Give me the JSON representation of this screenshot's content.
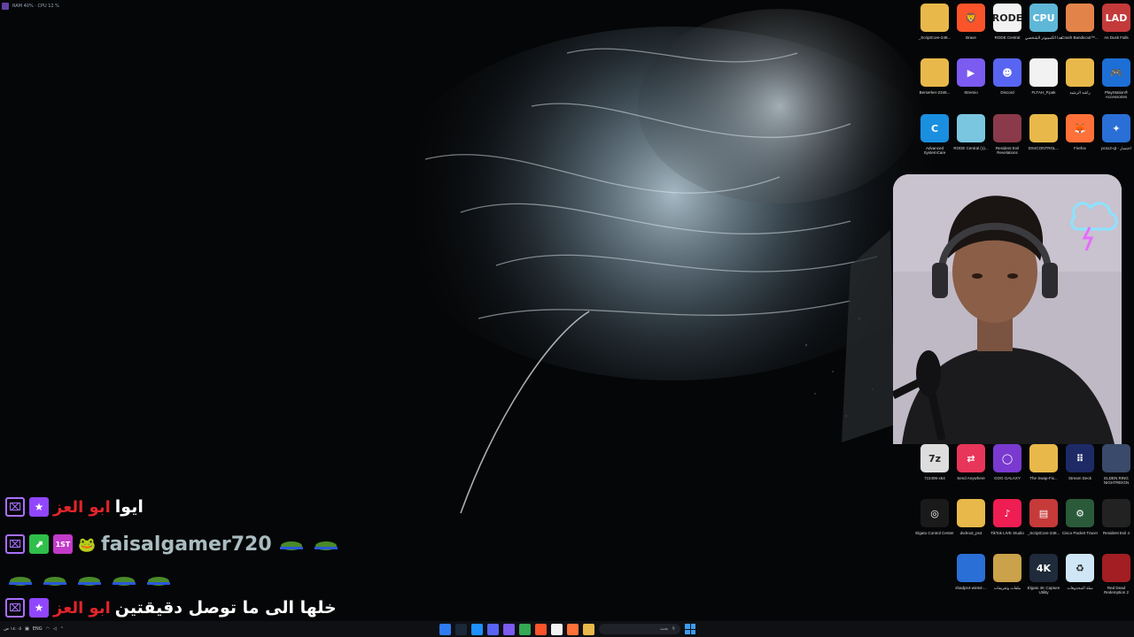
{
  "stats": {
    "text": "RAM 40% · CPU 12 %"
  },
  "desktop_icons": [
    {
      "id": "scriptcore",
      "label": "_ScriptCore-248...",
      "color": "#e8b94a",
      "glyph": ""
    },
    {
      "id": "brave",
      "label": "Brave",
      "color": "#fb542b",
      "glyph": "🦁"
    },
    {
      "id": "rode",
      "label": "RODE Central",
      "color": "#f2f2f2",
      "glyph": "RODE"
    },
    {
      "id": "thispc",
      "label": "هذا الكمبيوتر الشخصي",
      "color": "#5fb7d8",
      "glyph": "CPU"
    },
    {
      "id": "crash",
      "label": "Crash Bandicoot™...",
      "color": "#e2844a",
      "glyph": ""
    },
    {
      "id": "asdusk",
      "label": "As Dusk Falls",
      "color": "#c43a3a",
      "glyph": "LAD"
    },
    {
      "id": "berserker",
      "label": "Berserker-2346...",
      "color": "#e8b94a",
      "glyph": ""
    },
    {
      "id": "stremio",
      "label": "Stremio",
      "color": "#7b5bf0",
      "glyph": "▶"
    },
    {
      "id": "discord",
      "label": "Discord",
      "color": "#5865f2",
      "glyph": "☻"
    },
    {
      "id": "fltah",
      "label": "FLTAH_P.pak",
      "color": "#f2f2f2",
      "glyph": ""
    },
    {
      "id": "rashed",
      "label": "راشد الرشيد",
      "color": "#e8b94a",
      "glyph": ""
    },
    {
      "id": "psacc",
      "label": "PlayStation® Accessories",
      "color": "#1d6fd6",
      "glyph": "🎮"
    },
    {
      "id": "advsys",
      "label": "Advanced SystemCare",
      "color": "#1a8fe0",
      "glyph": "C"
    },
    {
      "id": "rodecentral2",
      "label": "RODE Central (1)...",
      "color": "#7ac6e0",
      "glyph": ""
    },
    {
      "id": "resevil",
      "label": "Resident Evil Revelations",
      "color": "#8a3a4a",
      "glyph": ""
    },
    {
      "id": "ds4",
      "label": "DS4CONTROL...",
      "color": "#e8b94a",
      "glyph": ""
    },
    {
      "id": "firefox",
      "label": "Firefox",
      "color": "#ff7139",
      "glyph": "🦊"
    },
    {
      "id": "pcsx2",
      "label": "pcsx2-qt - اختصار",
      "color": "#2a6fd6",
      "glyph": "✦"
    },
    {
      "id": "win7",
      "label": "7z2406-x64",
      "color": "#ddd",
      "glyph": "7z"
    },
    {
      "id": "sendanywhere",
      "label": "Send Anywhere",
      "color": "#e8355a",
      "glyph": "⇄"
    },
    {
      "id": "goggalaxy",
      "label": "GOG GALAXY",
      "color": "#7a3ad0",
      "glyph": "◯"
    },
    {
      "id": "fix",
      "label": "The Swap-Fix...",
      "color": "#e8b94a",
      "glyph": ""
    },
    {
      "id": "streamdeck",
      "label": "Stream Deck",
      "color": "#1e2a66",
      "glyph": "⠿"
    },
    {
      "id": "eldenring",
      "label": "ELDEN RING NIGHTREIGN",
      "color": "#3a4a6a",
      "glyph": ""
    },
    {
      "id": "elgato",
      "label": "Elgato Control Center",
      "color": "#1a1a1a",
      "glyph": "◎"
    },
    {
      "id": "dvdroot",
      "label": "dvdroot_ps4",
      "color": "#e8b94a",
      "glyph": ""
    },
    {
      "id": "tiktok",
      "label": "TikTok LIVE Studio",
      "color": "#ee1d52",
      "glyph": "♪"
    },
    {
      "id": "scriptcore2",
      "label": "_ScriptCore-248...",
      "color": "#c63a3a",
      "glyph": "▤"
    },
    {
      "id": "cisco",
      "label": "Cisco Packet Tracer",
      "color": "#2a5a3a",
      "glyph": "⚙"
    },
    {
      "id": "re4",
      "label": "Resident Evil 4",
      "color": "#222",
      "glyph": ""
    },
    {
      "id": "shadps4",
      "label": "shadps4-win64-...",
      "color": "#2a6fd6",
      "glyph": ""
    },
    {
      "id": "malfat",
      "label": "ملفات وتعريفات",
      "color": "#c9a24a",
      "glyph": ""
    },
    {
      "id": "elgato4k",
      "label": "Elgato 4K Capture Utility",
      "color": "#1f2a3a",
      "glyph": "4K"
    },
    {
      "id": "recycle",
      "label": "سلة المحذوفات",
      "color": "#cfe6f6",
      "glyph": "♻"
    },
    {
      "id": "rdr2",
      "label": "Red Dead Redemption 2",
      "color": "#a31e22",
      "glyph": ""
    }
  ],
  "webcam": {
    "alt": "streamer webcam"
  },
  "chat": {
    "messages": [
      {
        "user": "ابو العز",
        "text": "ايوا",
        "badges": [
          "twitch",
          "star"
        ]
      },
      {
        "user": "faisalgamer720",
        "text": "",
        "badges": [
          "twitch",
          "green",
          "first",
          "frog"
        ]
      },
      {
        "user": "",
        "text": "",
        "badges": []
      },
      {
        "user": "ابو العز",
        "text": "خلها الى ما توصل دقيقتين",
        "badges": [
          "twitch",
          "star"
        ]
      }
    ]
  },
  "taskbar": {
    "left_text": "ENG",
    "clock": "١٤:٠٥ ص",
    "search_placeholder": "بحث",
    "apps": [
      "edge",
      "steam",
      "explorer",
      "discord",
      "stremio",
      "chrome",
      "brave",
      "notes",
      "firefox",
      "files"
    ]
  }
}
